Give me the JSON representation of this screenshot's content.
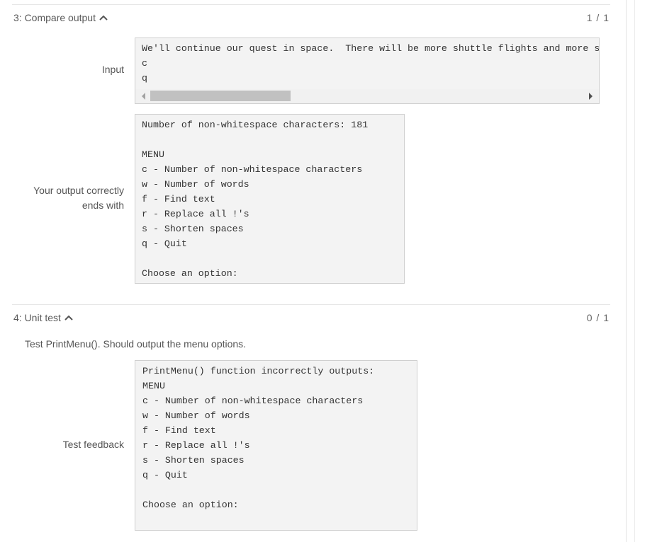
{
  "section3": {
    "title": "3: Compare output",
    "score": "1 / 1",
    "input_label": "Input",
    "input_lines": [
      "We'll continue our quest in space.  There will be more shuttle flights and more shuttle crews and,",
      "c",
      "q"
    ],
    "output_label_line1": "Your output correctly",
    "output_label_line2": "ends with",
    "output_lines": [
      "Number of non-whitespace characters: 181",
      "",
      "MENU",
      "c - Number of non-whitespace characters",
      "w - Number of words",
      "f - Find text",
      "r - Replace all !'s",
      "s - Shorten spaces",
      "q - Quit",
      "",
      "Choose an option:"
    ]
  },
  "section4": {
    "title": "4: Unit test",
    "score": "0 / 1",
    "description": "Test PrintMenu(). Should output the menu options.",
    "feedback_label": "Test feedback",
    "feedback_lines": [
      "PrintMenu() function incorrectly outputs:",
      "MENU",
      "c - Number of non-whitespace characters",
      "w - Number of words",
      "f - Find text",
      "r - Replace all !'s",
      "s - Shorten spaces",
      "q - Quit",
      "",
      "Choose an option:",
      ""
    ]
  },
  "icons": {
    "collapse": "chevron-up-icon",
    "scroll_left": "arrow-left-icon",
    "scroll_right": "arrow-right-icon"
  }
}
